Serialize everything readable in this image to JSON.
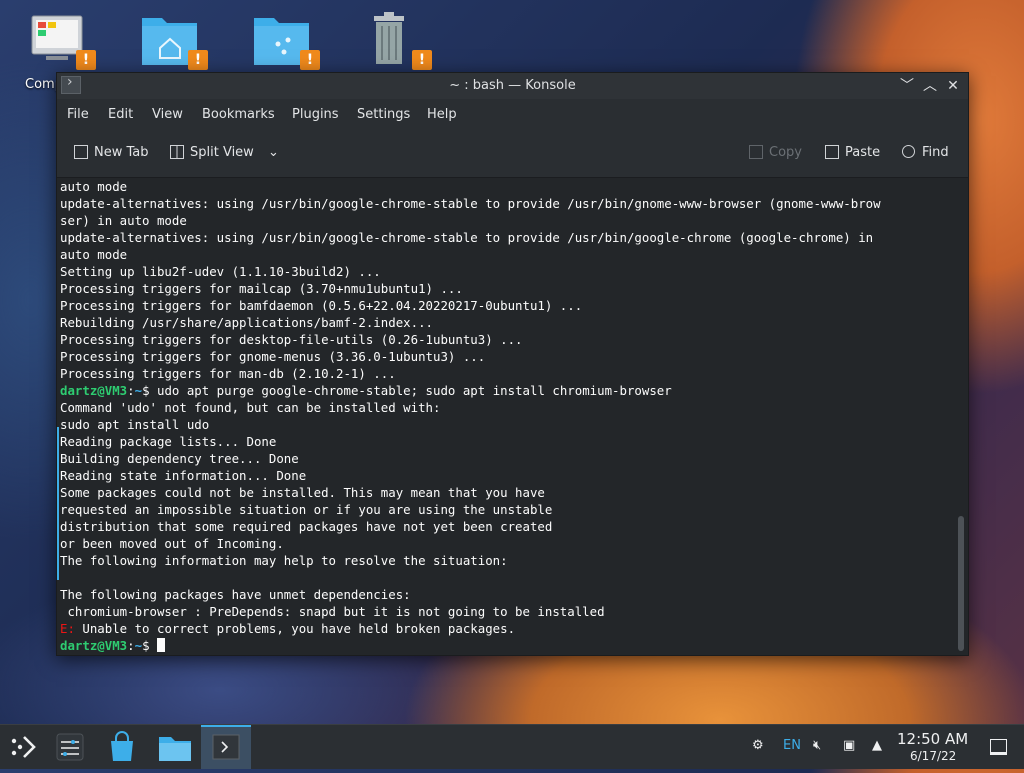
{
  "desktop": {
    "icons": [
      {
        "name": "computer",
        "label": "Comp"
      },
      {
        "name": "home-folder"
      },
      {
        "name": "network-folder"
      },
      {
        "name": "trash"
      }
    ]
  },
  "window": {
    "title": "~ : bash — Konsole",
    "menu": [
      "File",
      "Edit",
      "View",
      "Bookmarks",
      "Plugins",
      "Settings",
      "Help"
    ],
    "toolbar": {
      "new_tab": "New Tab",
      "split_view": "Split View",
      "copy": "Copy",
      "paste": "Paste",
      "find": "Find"
    }
  },
  "terminal": {
    "lines": [
      "auto mode",
      "update-alternatives: using /usr/bin/google-chrome-stable to provide /usr/bin/gnome-www-browser (gnome-www-brow",
      "ser) in auto mode",
      "update-alternatives: using /usr/bin/google-chrome-stable to provide /usr/bin/google-chrome (google-chrome) in",
      "auto mode",
      "Setting up libu2f-udev (1.1.10-3build2) ...",
      "Processing triggers for mailcap (3.70+nmu1ubuntu1) ...",
      "Processing triggers for bamfdaemon (0.5.6+22.04.20220217-0ubuntu1) ...",
      "Rebuilding /usr/share/applications/bamf-2.index...",
      "Processing triggers for desktop-file-utils (0.26-1ubuntu3) ...",
      "Processing triggers for gnome-menus (3.36.0-1ubuntu3) ...",
      "Processing triggers for man-db (2.10.2-1) ..."
    ],
    "prompt_user": "dartz@VM3",
    "prompt_path": "~",
    "prompt_sep": ":",
    "prompt_symbol": "$ ",
    "command": "udo apt purge google-chrome-stable; sudo apt install chromium-browser",
    "output": [
      "Command 'udo' not found, but can be installed with:",
      "sudo apt install udo",
      "Reading package lists... Done",
      "Building dependency tree... Done",
      "Reading state information... Done",
      "Some packages could not be installed. This may mean that you have",
      "requested an impossible situation or if you are using the unstable",
      "distribution that some required packages have not yet been created",
      "or been moved out of Incoming.",
      "The following information may help to resolve the situation:",
      "",
      "The following packages have unmet dependencies:",
      " chromium-browser : PreDepends: snapd but it is not going to be installed"
    ],
    "error_prefix": "E:",
    "error_text": " Unable to correct problems, you have held broken packages."
  },
  "taskbar": {
    "language": "EN",
    "time": "12:50 AM",
    "date": "6/17/22"
  }
}
